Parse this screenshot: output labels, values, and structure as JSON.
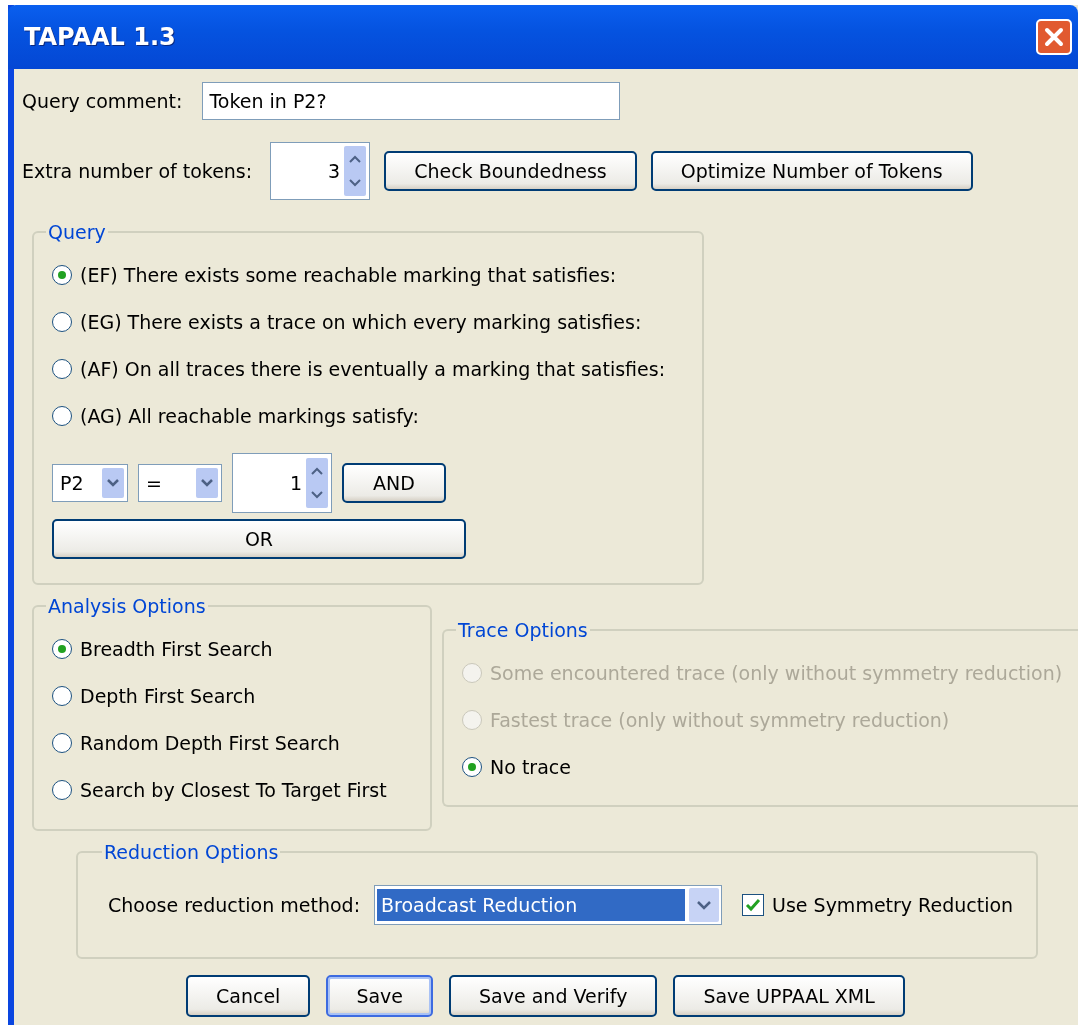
{
  "window": {
    "title": "TAPAAL 1.3"
  },
  "query_comment": {
    "label": "Query comment:",
    "value": "Token in P2?"
  },
  "extra_tokens": {
    "label": "Extra number of tokens:",
    "value": "3"
  },
  "token_buttons": [
    "Check Boundedness",
    "Optimize Number of Tokens"
  ],
  "query": {
    "title": "Query",
    "options": [
      {
        "label": "(EF) There exists some reachable marking that satisfies:",
        "selected": true
      },
      {
        "label": "(EG) There exists a trace on which every marking satisfies:",
        "selected": false
      },
      {
        "label": "(AF) On all traces there is eventually a marking that satisfies:",
        "selected": false
      },
      {
        "label": "(AG) All reachable markings satisfy:",
        "selected": false
      }
    ],
    "place": "P2",
    "operator": "=",
    "number": "1",
    "and_button": "AND",
    "or_button": "OR"
  },
  "analysis": {
    "title": "Analysis Options",
    "options": [
      {
        "label": "Breadth First Search",
        "selected": true
      },
      {
        "label": "Depth First Search",
        "selected": false
      },
      {
        "label": "Random Depth First Search",
        "selected": false
      },
      {
        "label": "Search by Closest To Target First",
        "selected": false
      }
    ]
  },
  "trace": {
    "title": "Trace Options",
    "options": [
      {
        "label": "Some encountered trace (only without symmetry reduction)",
        "selected": false,
        "disabled": true
      },
      {
        "label": "Fastest trace (only without symmetry reduction)",
        "selected": false,
        "disabled": true
      },
      {
        "label": "No trace",
        "selected": true,
        "disabled": false
      }
    ]
  },
  "reduction": {
    "title": "Reduction Options",
    "label": "Choose reduction method:",
    "method": "Broadcast Reduction",
    "symmetry": {
      "label": "Use Symmetry Reduction",
      "checked": true
    }
  },
  "buttons": [
    {
      "label": "Cancel",
      "focused": false
    },
    {
      "label": "Save",
      "focused": true
    },
    {
      "label": "Save and Verify",
      "focused": false
    },
    {
      "label": "Save UPPAAL XML",
      "focused": false
    }
  ]
}
